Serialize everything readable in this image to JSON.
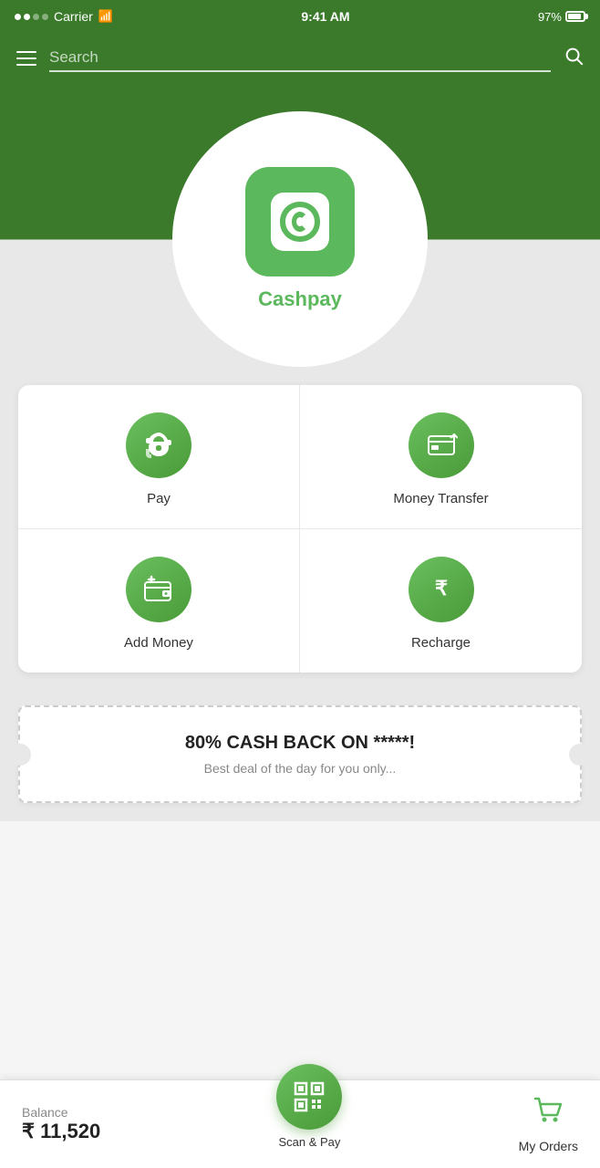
{
  "statusBar": {
    "carrier": "Carrier",
    "time": "9:41 AM",
    "battery": "97%"
  },
  "navbar": {
    "search_placeholder": "Search"
  },
  "hero": {
    "app_name": "Cashpay"
  },
  "actions": [
    {
      "id": "pay",
      "label": "Pay",
      "icon": "pay-icon"
    },
    {
      "id": "money-transfer",
      "label": "Money Transfer",
      "icon": "transfer-icon"
    },
    {
      "id": "add-money",
      "label": "Add Money",
      "icon": "wallet-icon"
    },
    {
      "id": "recharge",
      "label": "Recharge",
      "icon": "rupee-icon"
    }
  ],
  "promo": {
    "title": "80% CASH BACK ON *****!",
    "subtitle": "Best deal of the day for you only..."
  },
  "bottomBar": {
    "balance_label": "Balance",
    "balance_amount": "₹ 11,520",
    "scan_label": "Scan & Pay",
    "orders_label": "My Orders"
  }
}
